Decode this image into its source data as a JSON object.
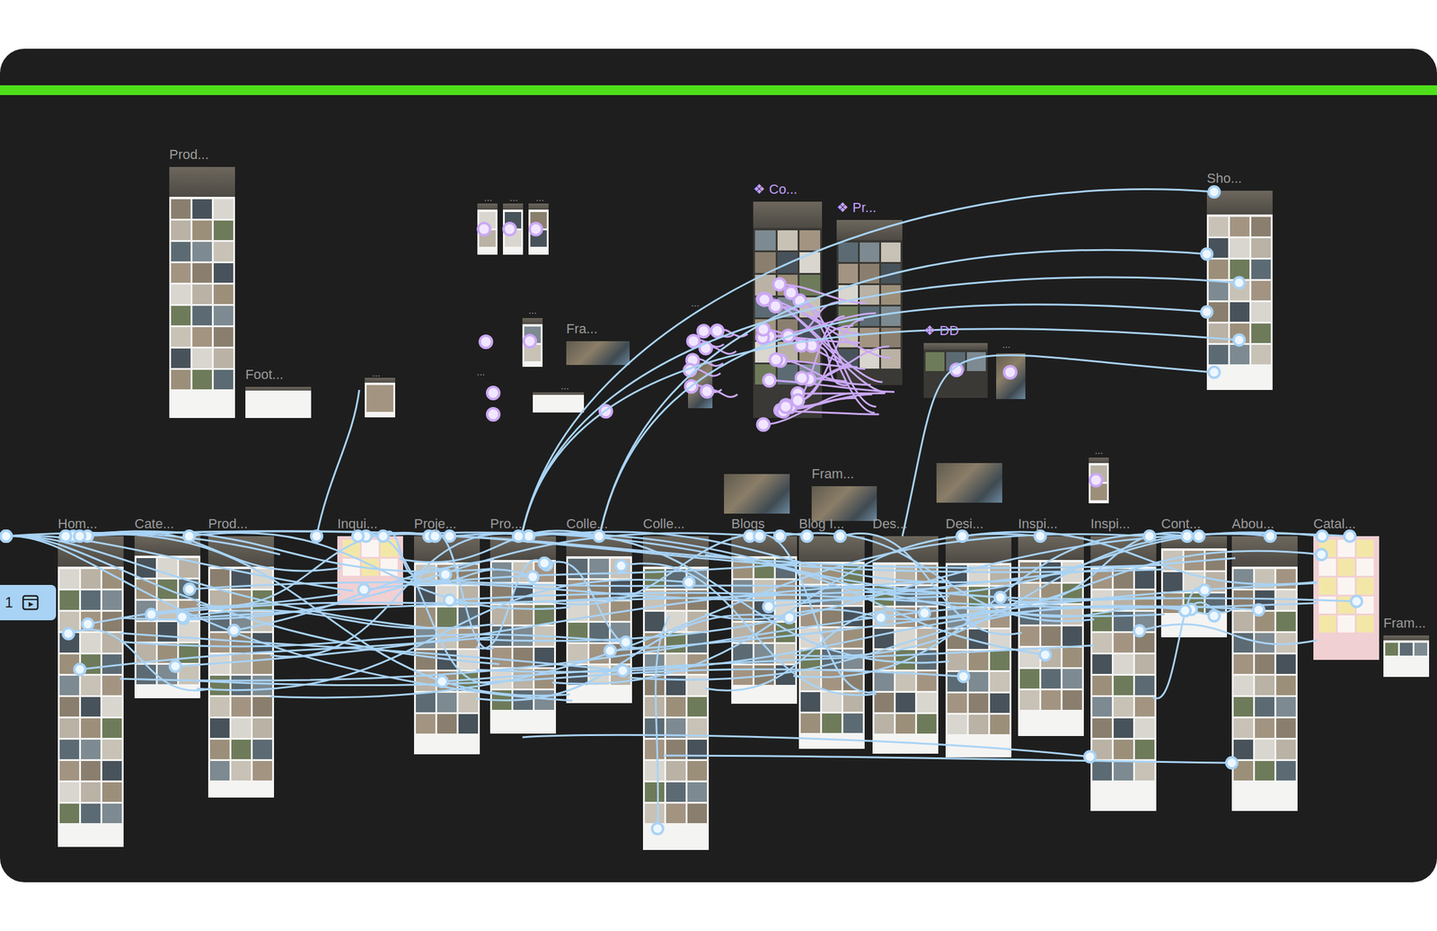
{
  "canvas": {
    "flow": {
      "label": "1"
    }
  },
  "frames": [
    {
      "label": "Prod...",
      "kind": "page"
    },
    {
      "label": "Foot...",
      "kind": "page"
    },
    {
      "label": "Sho...",
      "kind": "page"
    },
    {
      "label": "Co...",
      "kind": "component",
      "icon": "❖"
    },
    {
      "label": "Pr...",
      "kind": "component",
      "icon": "❖"
    },
    {
      "label": "DD",
      "kind": "component",
      "icon": "❖"
    },
    {
      "label": "Fra...",
      "kind": "photo"
    },
    {
      "label": "Fram...",
      "kind": "photo"
    },
    {
      "label": "Hom...",
      "kind": "page"
    },
    {
      "label": "Cate...",
      "kind": "page"
    },
    {
      "label": "Prod...",
      "kind": "page"
    },
    {
      "label": "Inqui...",
      "kind": "pink"
    },
    {
      "label": "Proje...",
      "kind": "page"
    },
    {
      "label": "Pro...",
      "kind": "page"
    },
    {
      "label": "Colle...",
      "kind": "page"
    },
    {
      "label": "Colle...",
      "kind": "page"
    },
    {
      "label": "Blogs",
      "kind": "page"
    },
    {
      "label": "Blog I...",
      "kind": "page"
    },
    {
      "label": "Des...",
      "kind": "page"
    },
    {
      "label": "Desi...",
      "kind": "page"
    },
    {
      "label": "Inspi...",
      "kind": "page"
    },
    {
      "label": "Inspi...",
      "kind": "page"
    },
    {
      "label": "Cont...",
      "kind": "page"
    },
    {
      "label": "Abou...",
      "kind": "page"
    },
    {
      "label": "Catal...",
      "kind": "pink"
    },
    {
      "label": "Fram...",
      "kind": "page"
    }
  ],
  "thumbnails": [
    {
      "kind": "photo"
    },
    {
      "kind": "photo"
    },
    {
      "kind": "page"
    },
    {
      "kind": "page"
    },
    {
      "kind": "page"
    },
    {
      "kind": "page"
    },
    {
      "kind": "page"
    },
    {
      "kind": "page"
    },
    {
      "kind": "page"
    },
    {
      "kind": "photo"
    },
    {
      "kind": "photo"
    }
  ],
  "markers": [
    {
      "text": "..."
    },
    {
      "text": "..."
    },
    {
      "text": "..."
    },
    {
      "text": "..."
    },
    {
      "text": "..."
    },
    {
      "text": "..."
    },
    {
      "text": "..."
    },
    {
      "text": "..."
    },
    {
      "text": "..."
    },
    {
      "text": "..."
    }
  ]
}
